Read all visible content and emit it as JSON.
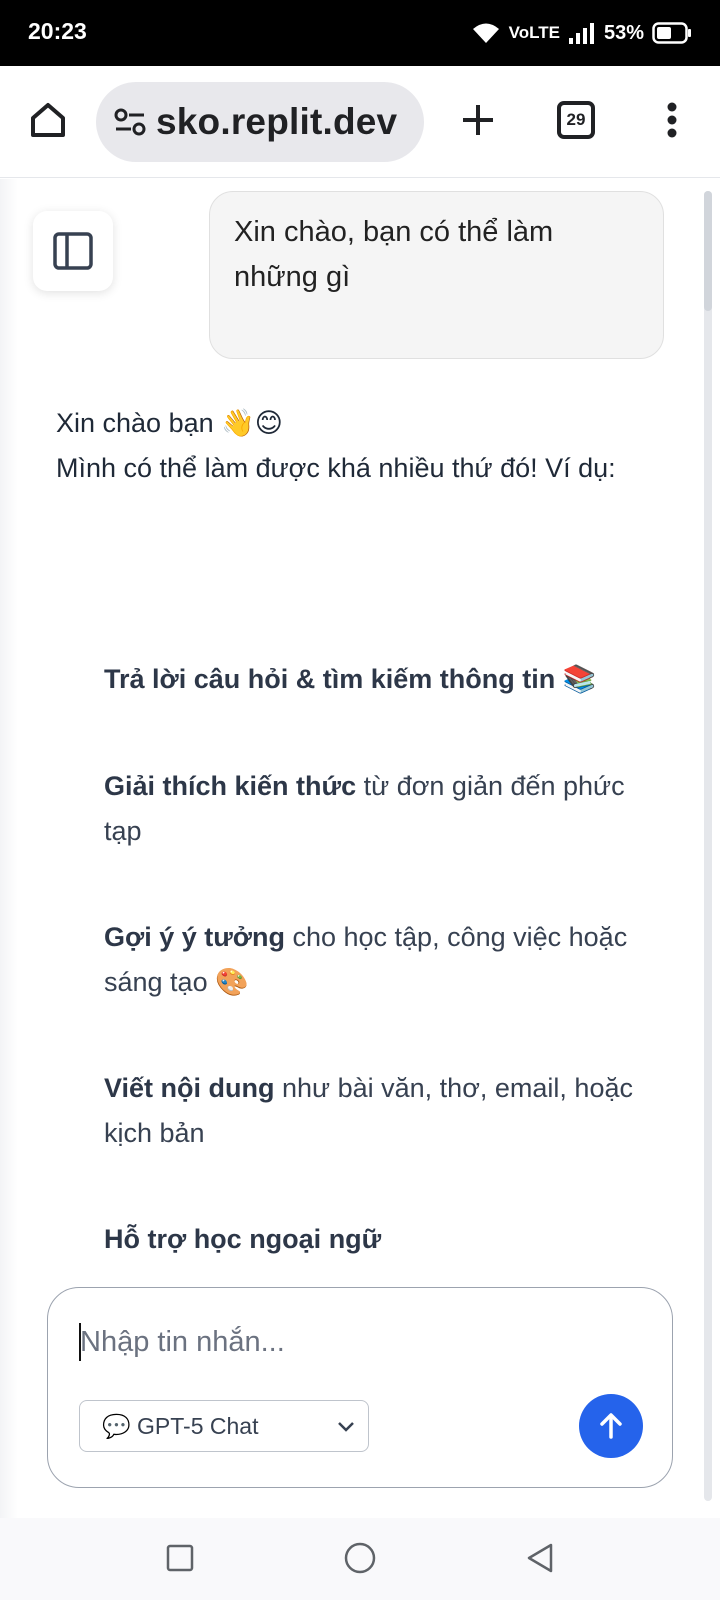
{
  "status_bar": {
    "time": "20:23",
    "network": "VoLTE",
    "battery": "53%",
    "battery_level": 0.53
  },
  "browser": {
    "url": "sko.replit.dev",
    "tab_count": "29",
    "icons": [
      "home-icon",
      "site-settings-icon",
      "new-tab-icon",
      "tab-switcher-icon",
      "more-menu-icon"
    ]
  },
  "chat": {
    "user_message": "Xin chào, bạn có thể làm những gì",
    "assistant_intro_line1": "Xin chào bạn 👋😊",
    "assistant_intro_line2": "Mình có thể làm được khá nhiều thứ đó! Ví dụ:",
    "items": [
      {
        "bold": "Trả lời câu hỏi & tìm kiếm thông tin 📚",
        "rest": ""
      },
      {
        "bold": "Giải thích kiến thức",
        "rest": " từ đơn giản đến phức tạp"
      },
      {
        "bold": "Gợi ý ý tưởng",
        "rest": " cho học tập, công việc hoặc sáng tạo 🎨"
      },
      {
        "bold": "Viết nội dung",
        "rest": " như bài văn, thơ, email, hoặc kịch bản"
      },
      {
        "bold": "Hỗ trợ học ngoại ngữ",
        "rest": ""
      }
    ]
  },
  "composer": {
    "placeholder": "Nhập tin nhắn...",
    "value": "",
    "model_selected": "💬 GPT-5 Chat"
  },
  "colors": {
    "accent": "#2563eb",
    "user_bubble_bg": "#f5f5f5",
    "status_bar_bg": "#000000"
  }
}
